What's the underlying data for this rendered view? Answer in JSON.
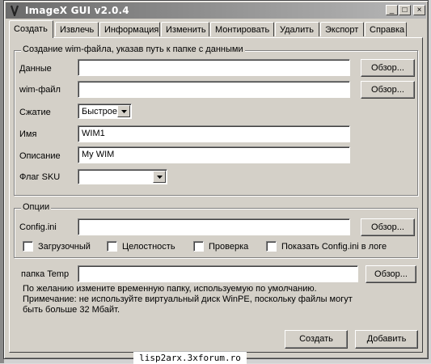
{
  "window": {
    "title": "ImageX GUI v2.0.4",
    "controls": {
      "minimize": "_",
      "maximize": "□",
      "close": "×"
    }
  },
  "tabs": [
    {
      "label": "Создать",
      "active": true
    },
    {
      "label": "Извлечь",
      "active": false
    },
    {
      "label": "Информация",
      "active": false
    },
    {
      "label": "Изменить",
      "active": false
    },
    {
      "label": "Монтировать",
      "active": false
    },
    {
      "label": "Удалить",
      "active": false
    },
    {
      "label": "Экспорт",
      "active": false
    },
    {
      "label": "Справка",
      "active": false
    }
  ],
  "create_group": {
    "legend": "Создание wim-файла, указав путь к папке с данными",
    "data_label": "Данные",
    "data_value": "",
    "wim_label": "wim-файл",
    "wim_value": "",
    "browse_label": "Обзор...",
    "compression_label": "Сжатие",
    "compression_value": "Быстрое",
    "name_label": "Имя",
    "name_value": "WIM1",
    "desc_label": "Описание",
    "desc_value": "My WIM",
    "sku_label": "Флаг SKU",
    "sku_value": ""
  },
  "options_group": {
    "legend": "Опции",
    "config_label": "Config.ini",
    "config_value": "",
    "browse_label": "Обзор...",
    "checkboxes": [
      {
        "label": "Загрузочный",
        "checked": false
      },
      {
        "label": "Целостность",
        "checked": false
      },
      {
        "label": "Проверка",
        "checked": false
      },
      {
        "label": "Показать Config.ini в логе",
        "checked": false
      }
    ]
  },
  "temp": {
    "label": "папка Temp",
    "value": "",
    "browse_label": "Обзор...",
    "note_lines": [
      "По желанию измените временную папку, используемую по умолчанию.",
      "Примечание: не используйте виртуальный диск WinPE, поскольку файлы могут",
      "быть больше 32 Мбайт."
    ]
  },
  "actions": {
    "create": "Создать",
    "add": "Добавить"
  },
  "watermark": "lisp2arx.3xforum.ro"
}
